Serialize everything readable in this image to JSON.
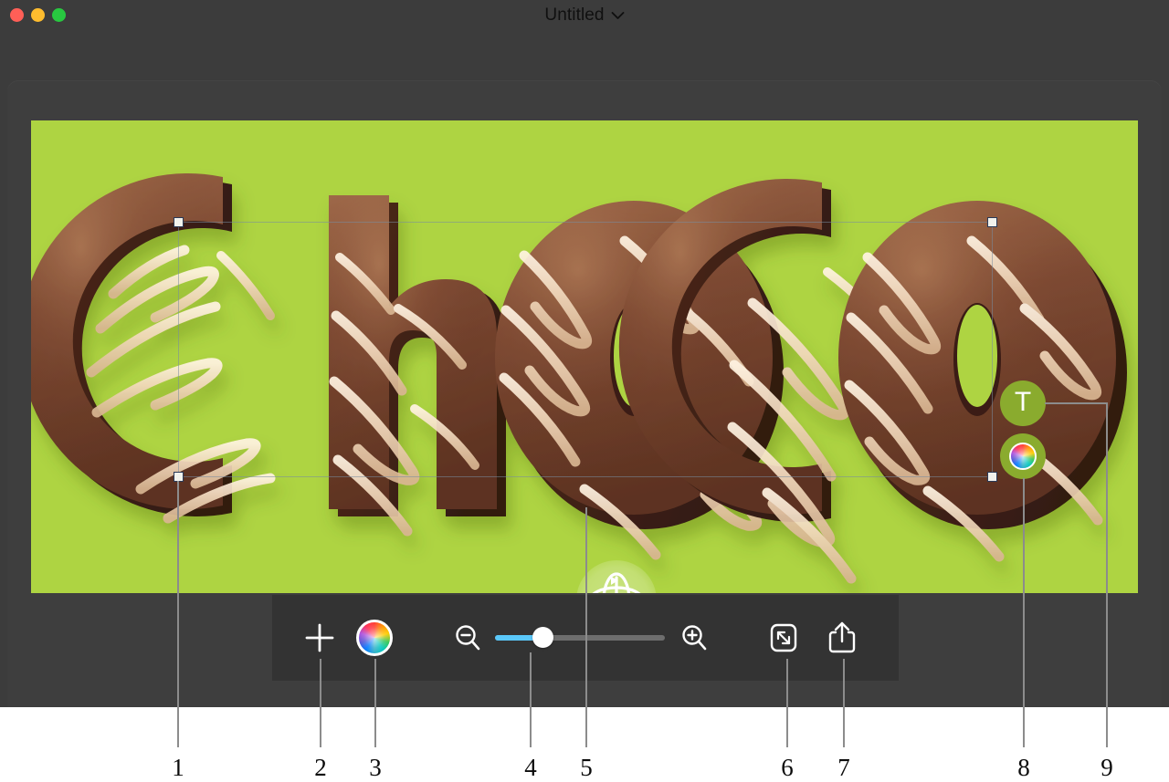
{
  "window": {
    "title": "Untitled",
    "title_chevron_icon": "chevron-down-icon",
    "background_color": "#3c3c3c",
    "traffic_lights": [
      {
        "name": "close",
        "color": "#ff5f57"
      },
      {
        "name": "minimize",
        "color": "#febc2e"
      },
      {
        "name": "zoom",
        "color": "#28c840"
      }
    ]
  },
  "canvas": {
    "background_color": "#aed442",
    "artwork_text": "choco",
    "artwork_style": "3d-chocolate-drizzle",
    "letters": [
      "c",
      "h",
      "o",
      "c",
      "o"
    ],
    "selection": {
      "visible": true,
      "handle_count": 4,
      "handle_fill": "#f2f2ec",
      "handle_border": "#2b3a57"
    },
    "rotate_gizmo_icon": "3d-rotate-icon"
  },
  "floating_buttons": [
    {
      "id": "text-tool",
      "label": "T",
      "icon": "text-tool-icon",
      "bg": "#8aab2e"
    },
    {
      "id": "color-tool",
      "label": "",
      "icon": "color-wheel-icon",
      "bg": "#8aab2e"
    }
  ],
  "toolbar": {
    "background_color": "#333333",
    "add_label": "",
    "add_icon": "plus-icon",
    "color_icon": "color-wheel-icon",
    "zoom_out_icon": "zoom-out-icon",
    "zoom_in_icon": "zoom-in-icon",
    "fit_icon": "resize-fit-icon",
    "share_icon": "share-icon",
    "zoom_slider": {
      "value": 28,
      "min": 0,
      "max": 100,
      "fill_color": "#5ac8fa",
      "track_color": "#6e6e6e",
      "knob_color": "#ffffff"
    }
  },
  "annotations": {
    "line_color": "#8c8c8c",
    "callouts": [
      {
        "number": "1",
        "target": "selection-handle"
      },
      {
        "number": "2",
        "target": "add-button"
      },
      {
        "number": "3",
        "target": "toolbar-color-button"
      },
      {
        "number": "4",
        "target": "zoom-slider"
      },
      {
        "number": "5",
        "target": "rotate-gizmo"
      },
      {
        "number": "6",
        "target": "fit-button"
      },
      {
        "number": "7",
        "target": "share-button"
      },
      {
        "number": "8",
        "target": "floating-color-button"
      },
      {
        "number": "9",
        "target": "floating-text-button"
      }
    ]
  }
}
